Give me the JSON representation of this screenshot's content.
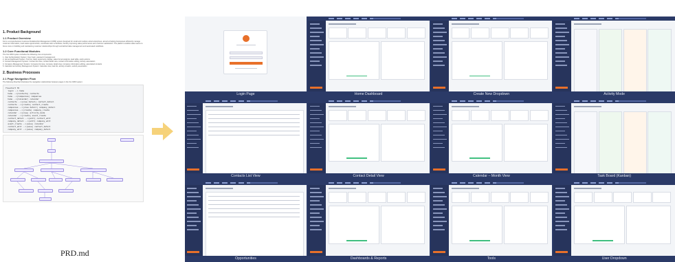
{
  "document": {
    "h1_background": "1. Product Background",
    "h2_overview": "1.1 Product Overview",
    "overview_text": "Koi is a comprehensive Customer Relationship Management (CRM) system designed for small and medium-sized enterprises, aimed at helping businesses efficiently manage customer information, track sales opportunities, coordinate team schedules, thereby improving sales performance and customer satisfaction. The platform enables sales teams to focus more on building and maintaining customer relationships through centralized data management and automated workflows.",
    "h2_modules": "1.2 Core Functional Modules",
    "modules_intro": "The Koi CRM system includes the following core components:",
    "modules": [
      "1. User Authentication System: User login, password management",
      "2. Home Dashboard System: Tool list, sales opportunity display, sales funnel analysis, lead table, quick actions",
      "3. Contact Management System: Contact list view, contact detail view, contact information editing, activity association",
      "4. Company Management System: Company list view, company detail view, company information editing, associated contacts",
      "5. Calendar and Activity Management System: Calendar view, task list, activity creation, activity association"
    ],
    "h1_processes": "2. Business Processes",
    "h2_nav": "2.1 Page Navigation Flow",
    "nav_intro": "The following flowchart illustrates the navigation relationships between pages in the Koi CRM system:",
    "code_lines": [
      "flowchart TD",
      "  login --> home",
      "  home -->|Contacts| contacts",
      "  home -->|Companies| companies",
      "  home -->|Calendar| calendar",
      "  contacts -->|view detail| contact_detail",
      "  contacts -->|create| contact_create",
      "  companies -->|view detail| company_detail",
      "  companies -->|create| company_create",
      "  calendar -->|view| activity_mode",
      "  calendar -->|create| event_create",
      "  contact_detail -->|edit| contact_edit",
      "  company_detail -->|edit| company_edit",
      "  event_create -->|save| calendar",
      "  contact_edit -->|save| contact_detail",
      "  company_edit -->|save| company_detail"
    ],
    "caption": "PRD.md"
  },
  "screens": [
    {
      "label": "Login Page"
    },
    {
      "label": "Home Dashboard"
    },
    {
      "label": "Create New Dropdown"
    },
    {
      "label": "Activity Mode"
    },
    {
      "label": "Contacts List View"
    },
    {
      "label": "Contact Detail View"
    },
    {
      "label": "Calendar – Month View"
    },
    {
      "label": "Task Board (Kanban)"
    },
    {
      "label": "Opportunities"
    },
    {
      "label": "Dashboards & Reports"
    },
    {
      "label": "Tools"
    },
    {
      "label": "User Dropdown"
    }
  ],
  "colors": {
    "navy": "#2b3a67",
    "accent": "#e8702a",
    "arrow": "#f6d27a"
  }
}
